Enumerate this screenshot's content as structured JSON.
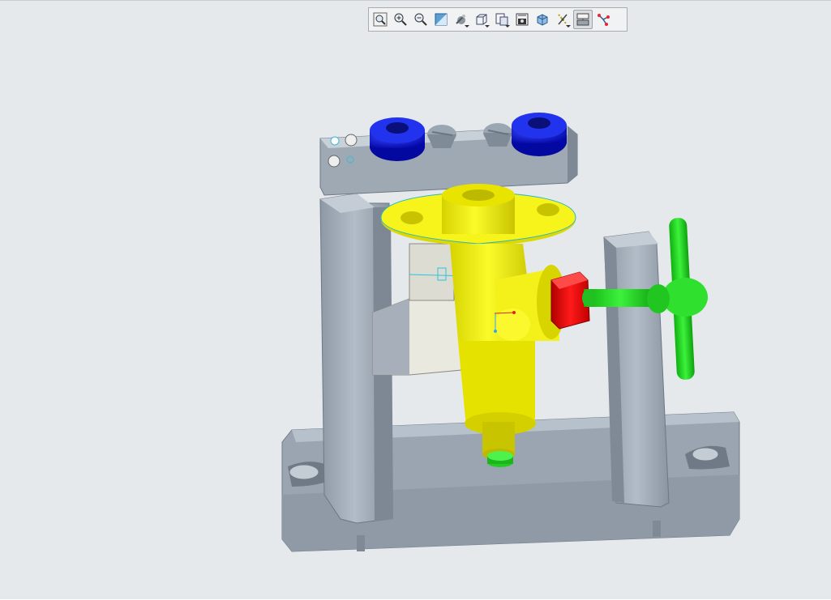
{
  "viewer": {
    "background": "#e6e9ec",
    "toolbar": {
      "buttons": [
        {
          "icon": "refit-icon",
          "dropdown": false
        },
        {
          "icon": "zoom-in-icon",
          "dropdown": false
        },
        {
          "icon": "zoom-out-icon",
          "dropdown": false
        },
        {
          "icon": "repaint-icon",
          "dropdown": false
        },
        {
          "icon": "display-style-icon",
          "dropdown": true
        },
        {
          "icon": "saved-views-icon",
          "dropdown": true
        },
        {
          "icon": "view-manager-icon",
          "dropdown": true
        },
        {
          "icon": "perspective-icon",
          "dropdown": false
        },
        {
          "icon": "section-icon",
          "dropdown": false
        },
        {
          "icon": "datum-display-icon",
          "dropdown": true
        },
        {
          "icon": "annotation-display-icon",
          "dropdown": false,
          "active": true
        },
        {
          "icon": "spin-center-icon",
          "dropdown": false
        }
      ]
    },
    "model": {
      "name": "fixture-assembly",
      "colors": {
        "base": "#a6b1bd",
        "workpiece": "#f2f000",
        "clamp_nuts": "#0a14d6",
        "handle": "#1fd51f",
        "hex_nut": "#e00000",
        "block": "#e8e8dc"
      }
    }
  }
}
